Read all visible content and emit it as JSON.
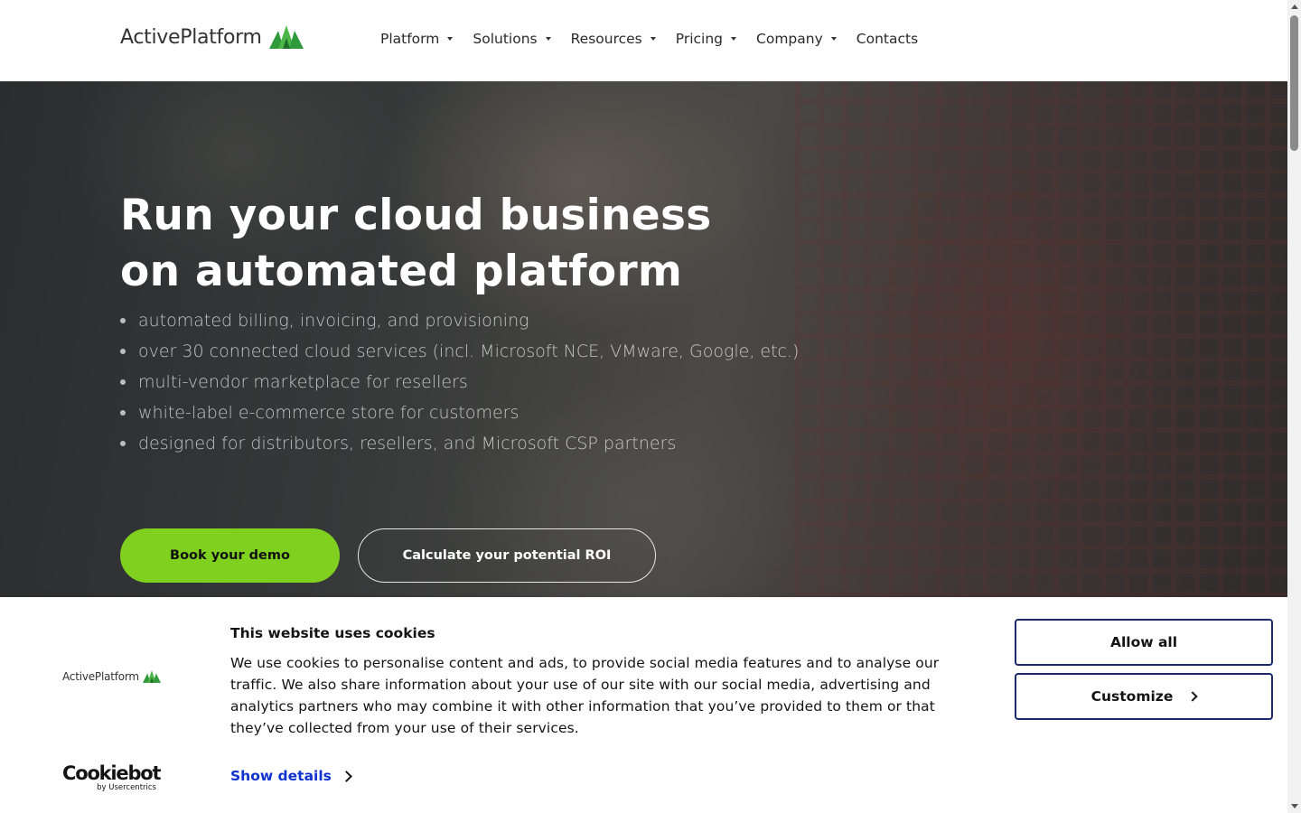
{
  "header": {
    "logo_text": "ActivePlatform",
    "nav": [
      {
        "label": "Platform",
        "has_dropdown": true
      },
      {
        "label": "Solutions",
        "has_dropdown": true
      },
      {
        "label": "Resources",
        "has_dropdown": true
      },
      {
        "label": "Pricing",
        "has_dropdown": true
      },
      {
        "label": "Company",
        "has_dropdown": true
      },
      {
        "label": "Contacts",
        "has_dropdown": false
      }
    ]
  },
  "hero": {
    "title_line1": "Run your cloud business",
    "title_line2": "on automated platform",
    "bullets": [
      "automated billing, invoicing, and provisioning",
      "over 30 connected cloud services (incl. Microsoft NCE, VMware, Google, etc.)",
      "multi-vendor marketplace for resellers",
      "white-label e-commerce store for customers",
      "designed for distributors, resellers, and Microsoft CSP partners"
    ],
    "primary_button": "Book your demo",
    "secondary_button": "Calculate your potential ROI"
  },
  "cookie_banner": {
    "logo_text": "ActivePlatform",
    "provider_name": "Cookiebot",
    "provider_sub": "by Usercentrics",
    "title": "This website uses cookies",
    "body": "We use cookies to personalise content and ads, to provide social media features and to analyse our traffic. We also share information about your use of our site with our social media, advertising and analytics partners who may combine it with other information that you’ve provided to them or that they’ve collected from your use of their services.",
    "show_details": "Show details",
    "allow_all": "Allow all",
    "customize": "Customize"
  },
  "colors": {
    "accent_green": "#80d11f",
    "link_blue": "#1032cf",
    "button_border_navy": "#1a2a6c"
  }
}
